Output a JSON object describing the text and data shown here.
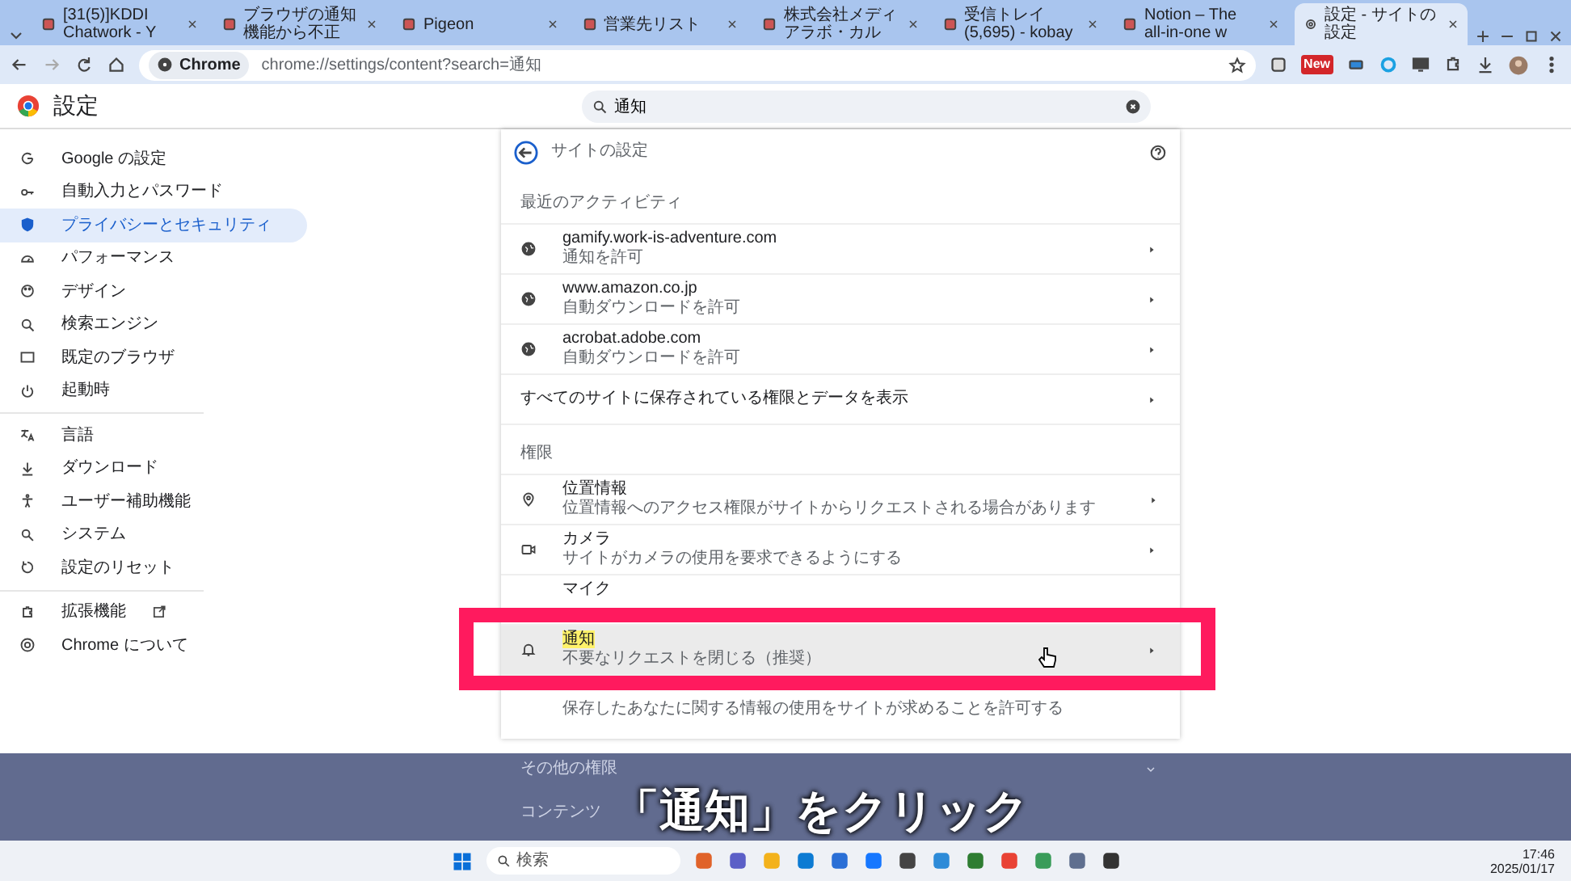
{
  "tabs": [
    {
      "title": "[31(5)]KDDI Chatwork - Y",
      "selected": false
    },
    {
      "title": "ブラウザの通知機能から不正",
      "selected": false
    },
    {
      "title": "Pigeon",
      "selected": false
    },
    {
      "title": "営業先リスト",
      "selected": false
    },
    {
      "title": "株式会社メディアラボ・カル",
      "selected": false
    },
    {
      "title": "受信トレイ (5,695) - kobay",
      "selected": false
    },
    {
      "title": "Notion – The all-in-one w",
      "selected": false
    },
    {
      "title": "設定 - サイトの設定",
      "selected": true
    }
  ],
  "toolbar": {
    "chip": "Chrome",
    "url": "chrome://settings/content?search=通知",
    "badge": "New"
  },
  "header": {
    "title": "設定",
    "search": {
      "value": "通知"
    }
  },
  "sidebar": {
    "sections": [
      [
        {
          "label": "Google の設定",
          "selected": false,
          "external": false
        },
        {
          "label": "自動入力とパスワード",
          "selected": false,
          "external": false
        },
        {
          "label": "プライバシーとセキュリティ",
          "selected": true,
          "external": false
        },
        {
          "label": "パフォーマンス",
          "selected": false,
          "external": false
        },
        {
          "label": "デザイン",
          "selected": false,
          "external": false
        },
        {
          "label": "検索エンジン",
          "selected": false,
          "external": false
        },
        {
          "label": "既定のブラウザ",
          "selected": false,
          "external": false
        },
        {
          "label": "起動時",
          "selected": false,
          "external": false
        }
      ],
      [
        {
          "label": "言語",
          "selected": false,
          "external": false
        },
        {
          "label": "ダウンロード",
          "selected": false,
          "external": false
        },
        {
          "label": "ユーザー補助機能",
          "selected": false,
          "external": false
        },
        {
          "label": "システム",
          "selected": false,
          "external": false
        },
        {
          "label": "設定のリセット",
          "selected": false,
          "external": false
        }
      ],
      [
        {
          "label": "拡張機能",
          "selected": false,
          "external": true
        },
        {
          "label": "Chrome について",
          "selected": false,
          "external": false
        }
      ]
    ]
  },
  "panel": {
    "title": "サイトの設定",
    "recent_heading": "最近のアクティビティ",
    "recent": [
      {
        "site": "gamify.work-is-adventure.com",
        "detail": "通知を許可"
      },
      {
        "site": "www.amazon.co.jp",
        "detail": "自動ダウンロードを許可"
      },
      {
        "site": "acrobat.adobe.com",
        "detail": "自動ダウンロードを許可"
      }
    ],
    "all_sites": "すべてのサイトに保存されている権限とデータを表示",
    "permissions_heading": "権限",
    "permissions": [
      {
        "kind": "location",
        "title": "位置情報",
        "subtitle": "位置情報へのアクセス権限がサイトからリクエストされる場合があります",
        "hovered": false,
        "match": false
      },
      {
        "kind": "camera",
        "title": "カメラ",
        "subtitle": "サイトがカメラの使用を要求できるようにする",
        "hovered": false,
        "match": false
      },
      {
        "kind": "mic",
        "title": "マイク",
        "hovered": false,
        "match": false
      },
      {
        "kind": "notification",
        "title": "通知",
        "subtitle": "不要なリクエストを閉じる（推奨）",
        "hovered": true,
        "match": true
      },
      {
        "kind": "plain",
        "subtitle": "保存したあなたに関する情報の使用をサイトが求めることを許可する",
        "hovered": false
      }
    ],
    "more": "その他の権限",
    "content_heading": "コンテンツ"
  },
  "caption": "「通知」をクリック",
  "taskbar": {
    "search": "検索",
    "time": "17:46",
    "date": "2025/01/17"
  }
}
